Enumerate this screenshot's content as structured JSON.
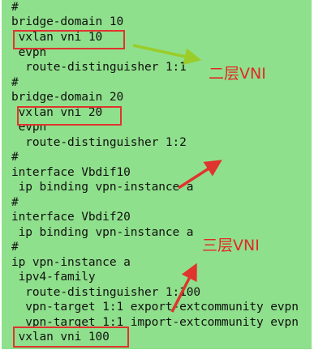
{
  "lines": [
    "#",
    "bridge-domain 10",
    " vxlan vni 10",
    " evpn",
    "  route-distinguisher 1:1",
    "#",
    "bridge-domain 20",
    " vxlan vni 20",
    " evpn",
    "  route-distinguisher 1:2",
    "#",
    "interface Vbdif10",
    " ip binding vpn-instance a",
    "#",
    "interface Vbdif20",
    " ip binding vpn-instance a",
    "#",
    "ip vpn-instance a",
    " ipv4-family",
    "  route-distinguisher 1:100",
    "  vpn-target 1:1 export-extcommunity evpn",
    "  vpn-target 1:1 import-extcommunity evpn",
    " vxlan vni 100"
  ],
  "annotations": {
    "layer2": "二层VNI",
    "layer3": "三层VNI"
  },
  "colors": {
    "background": "#8fe08c",
    "highlight_box": "#e0342e",
    "arrow_green": "#9acd2a",
    "arrow_red": "#e0342e",
    "annotation_text": "#e12a25"
  }
}
